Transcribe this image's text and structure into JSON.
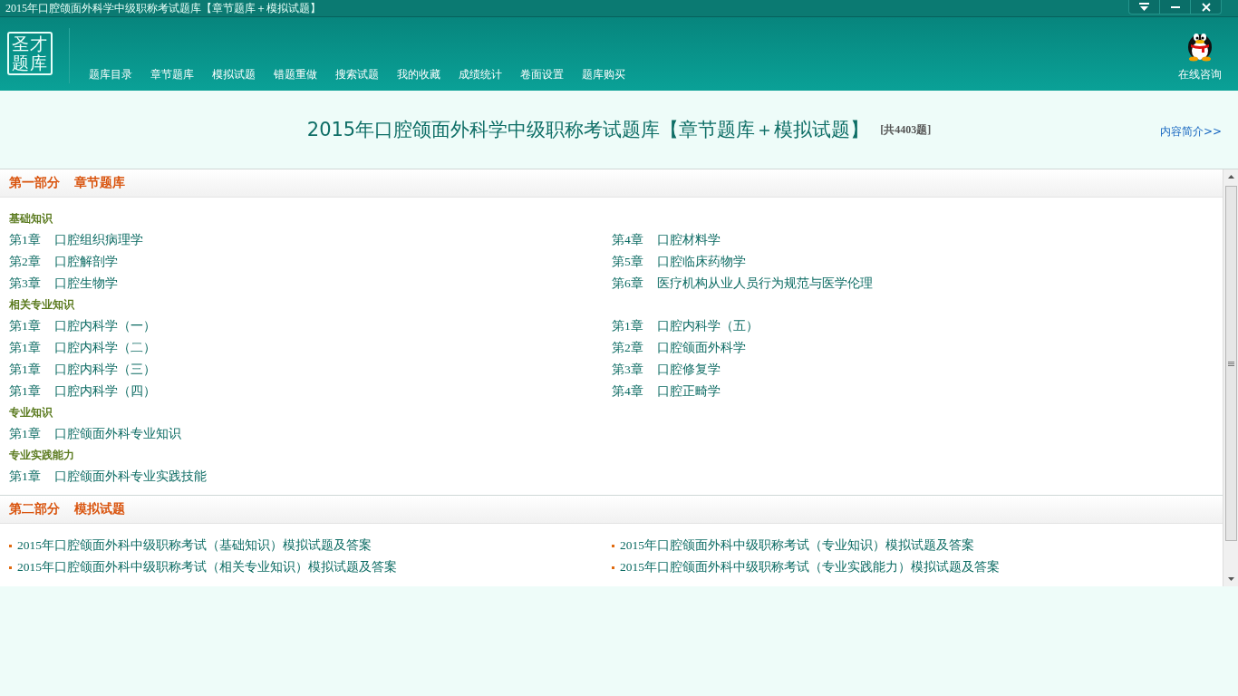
{
  "window": {
    "title": "2015年口腔颌面外科学中级职称考试题库【章节题库＋模拟试题】"
  },
  "logo": {
    "line1": "圣才",
    "line2": "题库"
  },
  "nav": [
    "题库目录",
    "章节题库",
    "模拟试题",
    "错题重做",
    "搜索试题",
    "我的收藏",
    "成绩统计",
    "卷面设置",
    "题库购买"
  ],
  "consult": {
    "label": "在线咨询"
  },
  "heading": {
    "title": "2015年口腔颌面外科学中级职称考试题库【章节题库＋模拟试题】",
    "count": "[共4403题]",
    "intro_link": "内容简介>>"
  },
  "parts": [
    {
      "kind": "chapters",
      "number": "第一部分",
      "name": "章节题库",
      "groups": [
        {
          "title": "基础知识",
          "left": [
            {
              "num": "第1章",
              "name": "口腔组织病理学"
            },
            {
              "num": "第2章",
              "name": "口腔解剖学"
            },
            {
              "num": "第3章",
              "name": "口腔生物学"
            }
          ],
          "right": [
            {
              "num": "第4章",
              "name": "口腔材料学"
            },
            {
              "num": "第5章",
              "name": "口腔临床药物学"
            },
            {
              "num": "第6章",
              "name": "医疗机构从业人员行为规范与医学伦理"
            }
          ]
        },
        {
          "title": "相关专业知识",
          "left": [
            {
              "num": "第1章",
              "name": "口腔内科学（一）"
            },
            {
              "num": "第1章",
              "name": "口腔内科学（二）"
            },
            {
              "num": "第1章",
              "name": "口腔内科学（三）"
            },
            {
              "num": "第1章",
              "name": "口腔内科学（四）"
            }
          ],
          "right": [
            {
              "num": "第1章",
              "name": "口腔内科学（五）"
            },
            {
              "num": "第2章",
              "name": "口腔颌面外科学"
            },
            {
              "num": "第3章",
              "name": "口腔修复学"
            },
            {
              "num": "第4章",
              "name": "口腔正畸学"
            }
          ]
        },
        {
          "title": "专业知识",
          "left": [
            {
              "num": "第1章",
              "name": "口腔颌面外科专业知识"
            }
          ]
        },
        {
          "title": "专业实践能力",
          "left": [
            {
              "num": "第1章",
              "name": "口腔颌面外科专业实践技能"
            }
          ]
        }
      ]
    },
    {
      "kind": "links",
      "number": "第二部分",
      "name": "模拟试题",
      "left": [
        "2015年口腔颌面外科中级职称考试（基础知识）模拟试题及答案",
        "2015年口腔颌面外科中级职称考试（相关专业知识）模拟试题及答案"
      ],
      "right": [
        "2015年口腔颌面外科中级职称考试（专业知识）模拟试题及答案",
        "2015年口腔颌面外科中级职称考试（专业实践能力）模拟试题及答案"
      ]
    }
  ]
}
